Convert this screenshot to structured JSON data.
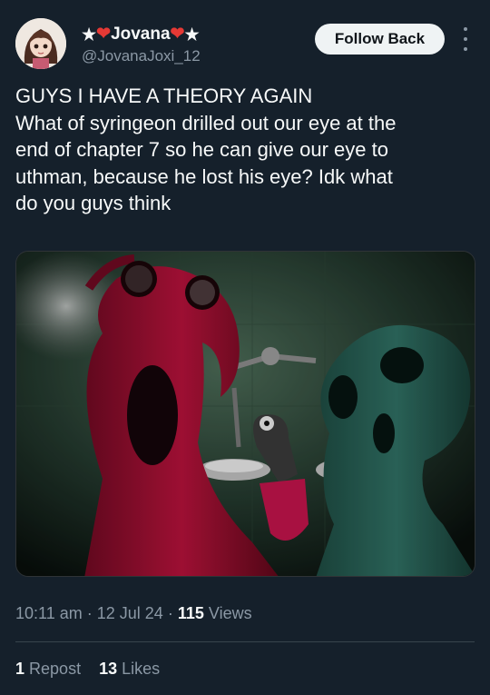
{
  "author": {
    "display_name_prefix": "★",
    "display_name_text": "Jovana",
    "display_name_suffix": "★",
    "handle": "@JovanaJoxi_12",
    "avatar_icon": "anime-girl-avatar"
  },
  "actions": {
    "follow_label": "Follow Back",
    "more_icon": "more-vertical-icon"
  },
  "tweet": {
    "lines": [
      "GUYS I HAVE A THEORY AGAIN",
      "What of syringeon drilled out our eye at the",
      "end of chapter 7 so he can give our eye to",
      "uthman, because he lost his eye? Idk what",
      "do you guys think"
    ]
  },
  "media": {
    "type": "image",
    "colors": {
      "bg_dark": "#0a120e",
      "bg_green": "#3d5a48",
      "red_creature": "#b3123a",
      "teal_creature": "#2f6e62"
    }
  },
  "meta": {
    "time": "10:11 am",
    "sep1": "·",
    "date": "12 Jul 24",
    "sep2": "·",
    "views_count": "115",
    "views_label": "Views"
  },
  "stats": {
    "reposts_count": "1",
    "reposts_label": "Repost",
    "likes_count": "13",
    "likes_label": "Likes"
  },
  "colors": {
    "background": "#15202b",
    "text_primary": "#f7f9f9",
    "text_secondary": "#8b98a5",
    "heart": "#e53935",
    "divider": "#38444d"
  }
}
